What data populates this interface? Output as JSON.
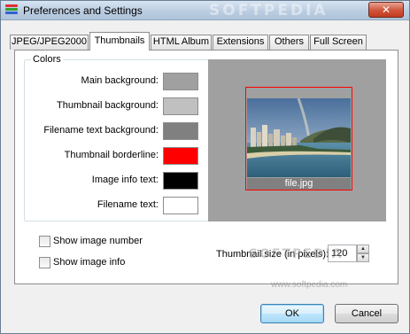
{
  "window": {
    "title": "Preferences and Settings",
    "close_glyph": "✕",
    "watermark_top": "SOFTPEDIA"
  },
  "tabs": [
    {
      "label": "JPEG/JPEG2000"
    },
    {
      "label": "Thumbnails",
      "active": true
    },
    {
      "label": "HTML Album"
    },
    {
      "label": "Extensions"
    },
    {
      "label": "Others"
    },
    {
      "label": "Full Screen"
    }
  ],
  "colors_group": {
    "title": "Colors",
    "rows": [
      {
        "label": "Main background:",
        "color": "#a0a0a0"
      },
      {
        "label": "Thumbnail background:",
        "color": "#c0c0c0"
      },
      {
        "label": "Filename text background:",
        "color": "#808080"
      },
      {
        "label": "Thumbnail borderline:",
        "color": "#ff0000"
      },
      {
        "label": "Image info text:",
        "color": "#000000"
      },
      {
        "label": "Filename text:",
        "color": "#ffffff"
      }
    ]
  },
  "preview": {
    "filename": "file.jpg"
  },
  "options": {
    "show_image_number": {
      "label": "Show image number",
      "checked": false
    },
    "show_image_info": {
      "label": "Show image info",
      "checked": false
    },
    "thumbnail_size_label": "Thumbnail size (in pixels):",
    "thumbnail_size_value": "120"
  },
  "watermark_bottom": "SOFTPEDIA",
  "watermark_url": "www.softpedia.com",
  "buttons": {
    "ok": "OK",
    "cancel": "Cancel"
  }
}
